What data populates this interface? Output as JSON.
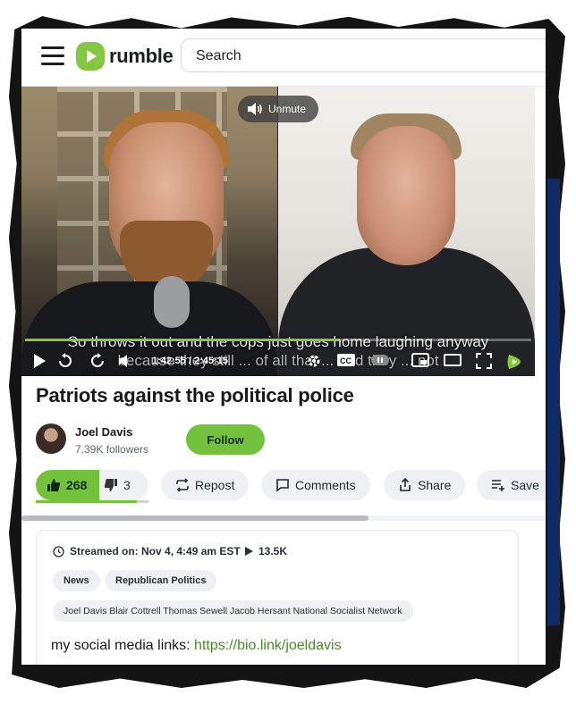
{
  "header": {
    "logo_text": "rumble",
    "search_label": "Search"
  },
  "video": {
    "unmute_label": "Unmute",
    "caption_line1": "So throws it out and the cops just goes home laughing anyway",
    "caption_line2": "because they still ... of all that ... and they ... not",
    "time": "1:42:55 / 2:45:15",
    "progress": 0.62
  },
  "title": "Patriots against the political police",
  "channel": {
    "name": "Joel Davis",
    "followers": "7.39K followers",
    "follow_label": "Follow"
  },
  "actions": {
    "likes": "268",
    "dislikes": "3",
    "repost": "Repost",
    "comments": "Comments",
    "share": "Share",
    "save": "Save"
  },
  "details": {
    "streamed": "Streamed on: Nov 4, 4:49 am EST",
    "views": "13.5K",
    "tags": [
      "News",
      "Republican Politics"
    ],
    "keywords": "Joel Davis Blair Cottrell Thomas Sewell Jacob Hersant National Socialist Network",
    "desc_prefix": "my social media links: ",
    "desc_link": "https://bio.link/joeldavis"
  },
  "colors": {
    "brand_green": "#74c13e",
    "link_green": "#4c8a28"
  }
}
